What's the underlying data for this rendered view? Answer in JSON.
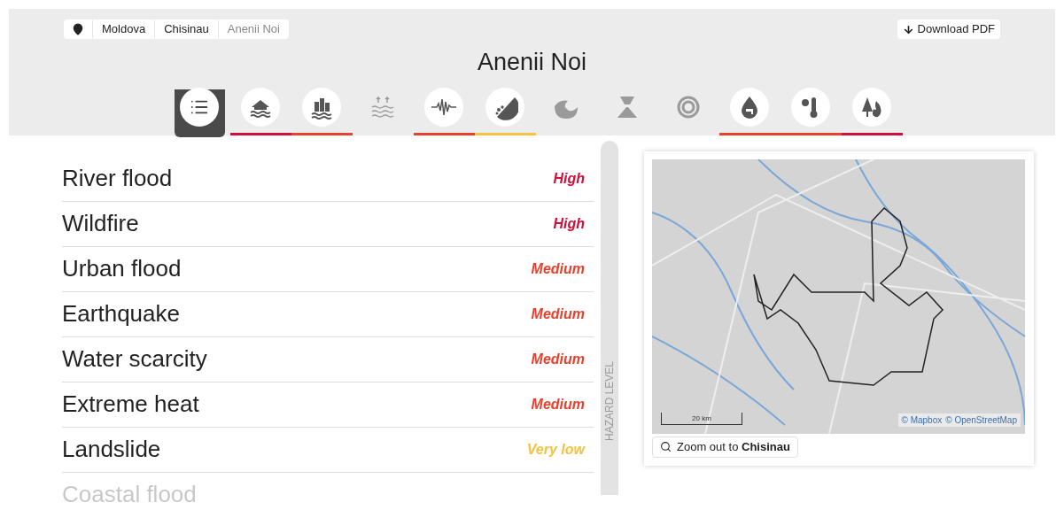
{
  "breadcrumb": [
    {
      "label": "Moldova",
      "current": false
    },
    {
      "label": "Chisinau",
      "current": false
    },
    {
      "label": "Anenii Noi",
      "current": true
    }
  ],
  "download": {
    "label": "Download PDF"
  },
  "title": "Anenii Noi",
  "hazard_tabs": [
    {
      "kind": "list",
      "selected": true,
      "disabled": false
    },
    {
      "kind": "river-flood",
      "selected": false,
      "disabled": false,
      "color": "#d0103a"
    },
    {
      "kind": "urban-flood",
      "selected": false,
      "disabled": false,
      "color": "#e8422f"
    },
    {
      "kind": "coastal-flood",
      "selected": false,
      "disabled": true
    },
    {
      "kind": "earthquake",
      "selected": false,
      "disabled": false,
      "color": "#e8422f"
    },
    {
      "kind": "landslide",
      "selected": false,
      "disabled": false,
      "color": "#f5c242"
    },
    {
      "kind": "tsunami",
      "selected": false,
      "disabled": true
    },
    {
      "kind": "volcano",
      "selected": false,
      "disabled": true
    },
    {
      "kind": "cyclone",
      "selected": false,
      "disabled": true
    },
    {
      "kind": "water-scarcity",
      "selected": false,
      "disabled": false,
      "color": "#e8422f"
    },
    {
      "kind": "extreme-heat",
      "selected": false,
      "disabled": false,
      "color": "#e8422f"
    },
    {
      "kind": "wildfire",
      "selected": false,
      "disabled": false,
      "color": "#d0103a"
    }
  ],
  "hazards": [
    {
      "name": "River flood",
      "level": "High",
      "color": "#d0103a"
    },
    {
      "name": "Wildfire",
      "level": "High",
      "color": "#d0103a"
    },
    {
      "name": "Urban flood",
      "level": "Medium",
      "color": "#e8422f"
    },
    {
      "name": "Earthquake",
      "level": "Medium",
      "color": "#e8422f"
    },
    {
      "name": "Water scarcity",
      "level": "Medium",
      "color": "#e8422f"
    },
    {
      "name": "Extreme heat",
      "level": "Medium",
      "color": "#e8422f"
    },
    {
      "name": "Landslide",
      "level": "Very low",
      "color": "#f5c242"
    },
    {
      "name": "Coastal flood",
      "color": "#c8c8c8"
    }
  ],
  "axis_label": "HAZARD LEVEL",
  "map": {
    "scale": "20 km",
    "attribution": [
      "© Mapbox",
      "© OpenStreetMap"
    ],
    "zoom_button": {
      "text": "Zoom out to",
      "place": "Chisinau"
    }
  }
}
